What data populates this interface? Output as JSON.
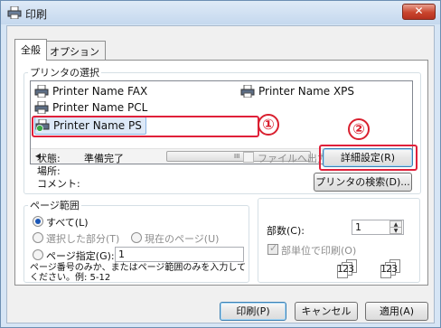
{
  "window": {
    "title": "印刷",
    "close_glyph": "✕"
  },
  "tabs": [
    {
      "label": "全般",
      "active": true
    },
    {
      "label": "オプション",
      "active": false
    }
  ],
  "printer_group": {
    "legend": "プリンタの選択",
    "printers": [
      {
        "name": "Printer Name FAX",
        "icon": "printer-icon"
      },
      {
        "name": "Printer Name XPS",
        "icon": "printer-icon"
      },
      {
        "name": "Printer Name PCL",
        "icon": "printer-icon"
      },
      {
        "name": "Printer Name PS",
        "icon": "default-printer-icon",
        "selected": true
      }
    ],
    "scroll_grip": "III",
    "status_label": "状態:",
    "status_value": "準備完了",
    "location_label": "場所:",
    "comment_label": "コメント:",
    "print_to_file_label": "ファイルへ出力(F)",
    "print_to_file_checked": false,
    "preferences_button": "詳細設定(R)",
    "find_printer_button": "プリンタの検索(D)..."
  },
  "page_range_group": {
    "legend": "ページ範囲",
    "all_label": "すべて(L)",
    "selection_label": "選択した部分(T)",
    "current_page_label": "現在のページ(U)",
    "pages_label": "ページ指定(G):",
    "pages_value": "1",
    "hint": "ページ番号のみか、またはページ範囲のみを入力してください。例: 5-12",
    "selected": "all"
  },
  "copies": {
    "label": "部数(C):",
    "value": "1",
    "collate_label": "部単位で印刷(O)",
    "collate_checked": true,
    "collate_pages_a": "123",
    "collate_pages_b": "123"
  },
  "footer": {
    "print_button": "印刷(P)",
    "cancel_button": "キャンセル",
    "apply_button": "適用(A)"
  },
  "annotations": {
    "marker_1": "①",
    "marker_2": "②",
    "color": "#e0203a"
  }
}
